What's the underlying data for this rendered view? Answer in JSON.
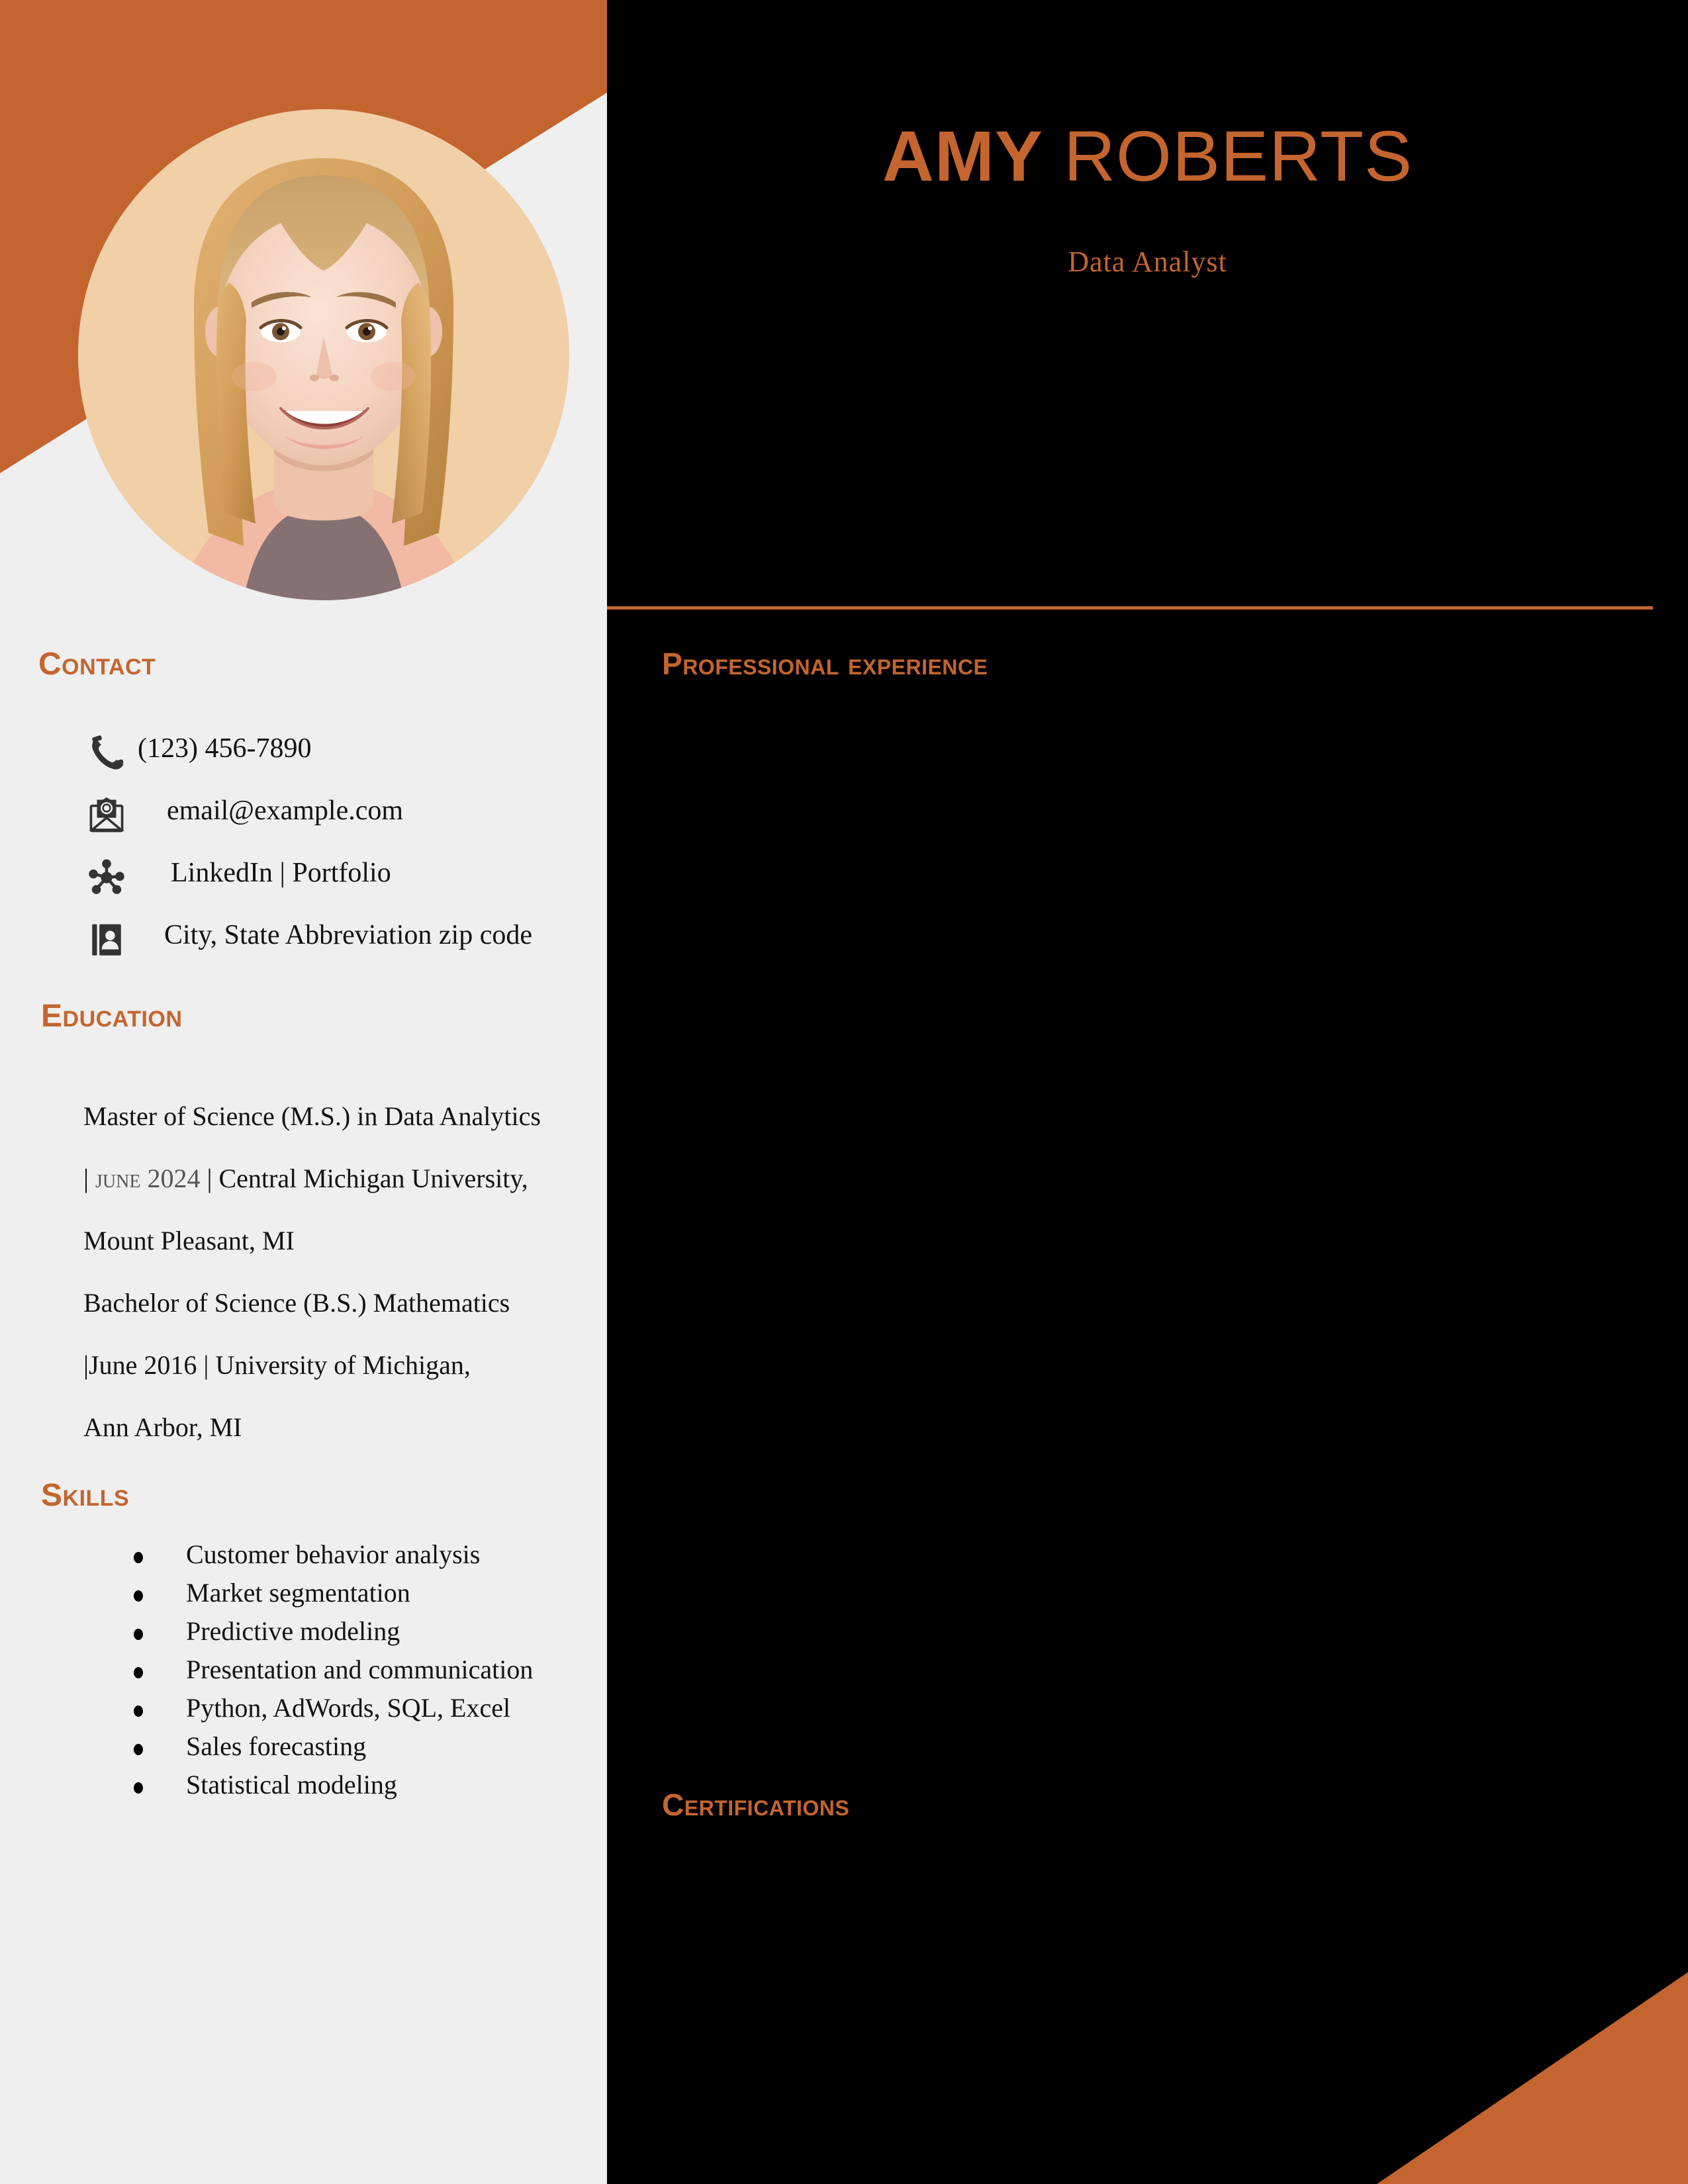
{
  "theme": {
    "accent": "#c4652f",
    "sidebar_bg": "#efefef",
    "panel_bg": "#000000",
    "body_text": "#131313",
    "muted_text": "#555555",
    "avatar_bg": "#f1cfa7"
  },
  "header": {
    "name_first": "AMY",
    "name_last": "ROBERTS",
    "job_title": "Data Analyst"
  },
  "sidebar": {
    "contact": {
      "heading": "CONTACT",
      "items": [
        {
          "icon": "phone-icon",
          "text": "(123) 456-7890"
        },
        {
          "icon": "envelope-at-icon",
          "text": "email@example.com"
        },
        {
          "icon": "network-share-icon",
          "text": "LinkedIn | Portfolio"
        },
        {
          "icon": "address-book-icon",
          "text": "City, State Abbreviation zip code"
        }
      ]
    },
    "education": {
      "heading": "EDUCATION",
      "entries": [
        {
          "degree": "Master of Science (M.S.) in Data Analytics",
          "date_prefix": "| ",
          "date": "JUNE 2024",
          "date_suffix": " | ",
          "school": "Central Michigan University,",
          "location": "Mount Pleasant, MI"
        },
        {
          "degree": "Bachelor of Science (B.S.) Mathematics",
          "date_prefix": "|",
          "date": "June 2016",
          "date_suffix": " | ",
          "school": "University of Michigan,",
          "location": "Ann Arbor, MI"
        }
      ]
    },
    "skills": {
      "heading": "SKILLS",
      "items": [
        "Customer behavior analysis",
        "Market segmentation",
        "Predictive modeling",
        "Presentation and communication",
        "Python, AdWords, SQL, Excel",
        "Sales forecasting",
        "Statistical modeling"
      ]
    }
  },
  "main": {
    "experience": {
      "heading": "PROFESSIONAL EXPERIENCE",
      "entries": []
    },
    "certifications": {
      "heading": "CERTIFICATIONS",
      "entries": []
    }
  }
}
